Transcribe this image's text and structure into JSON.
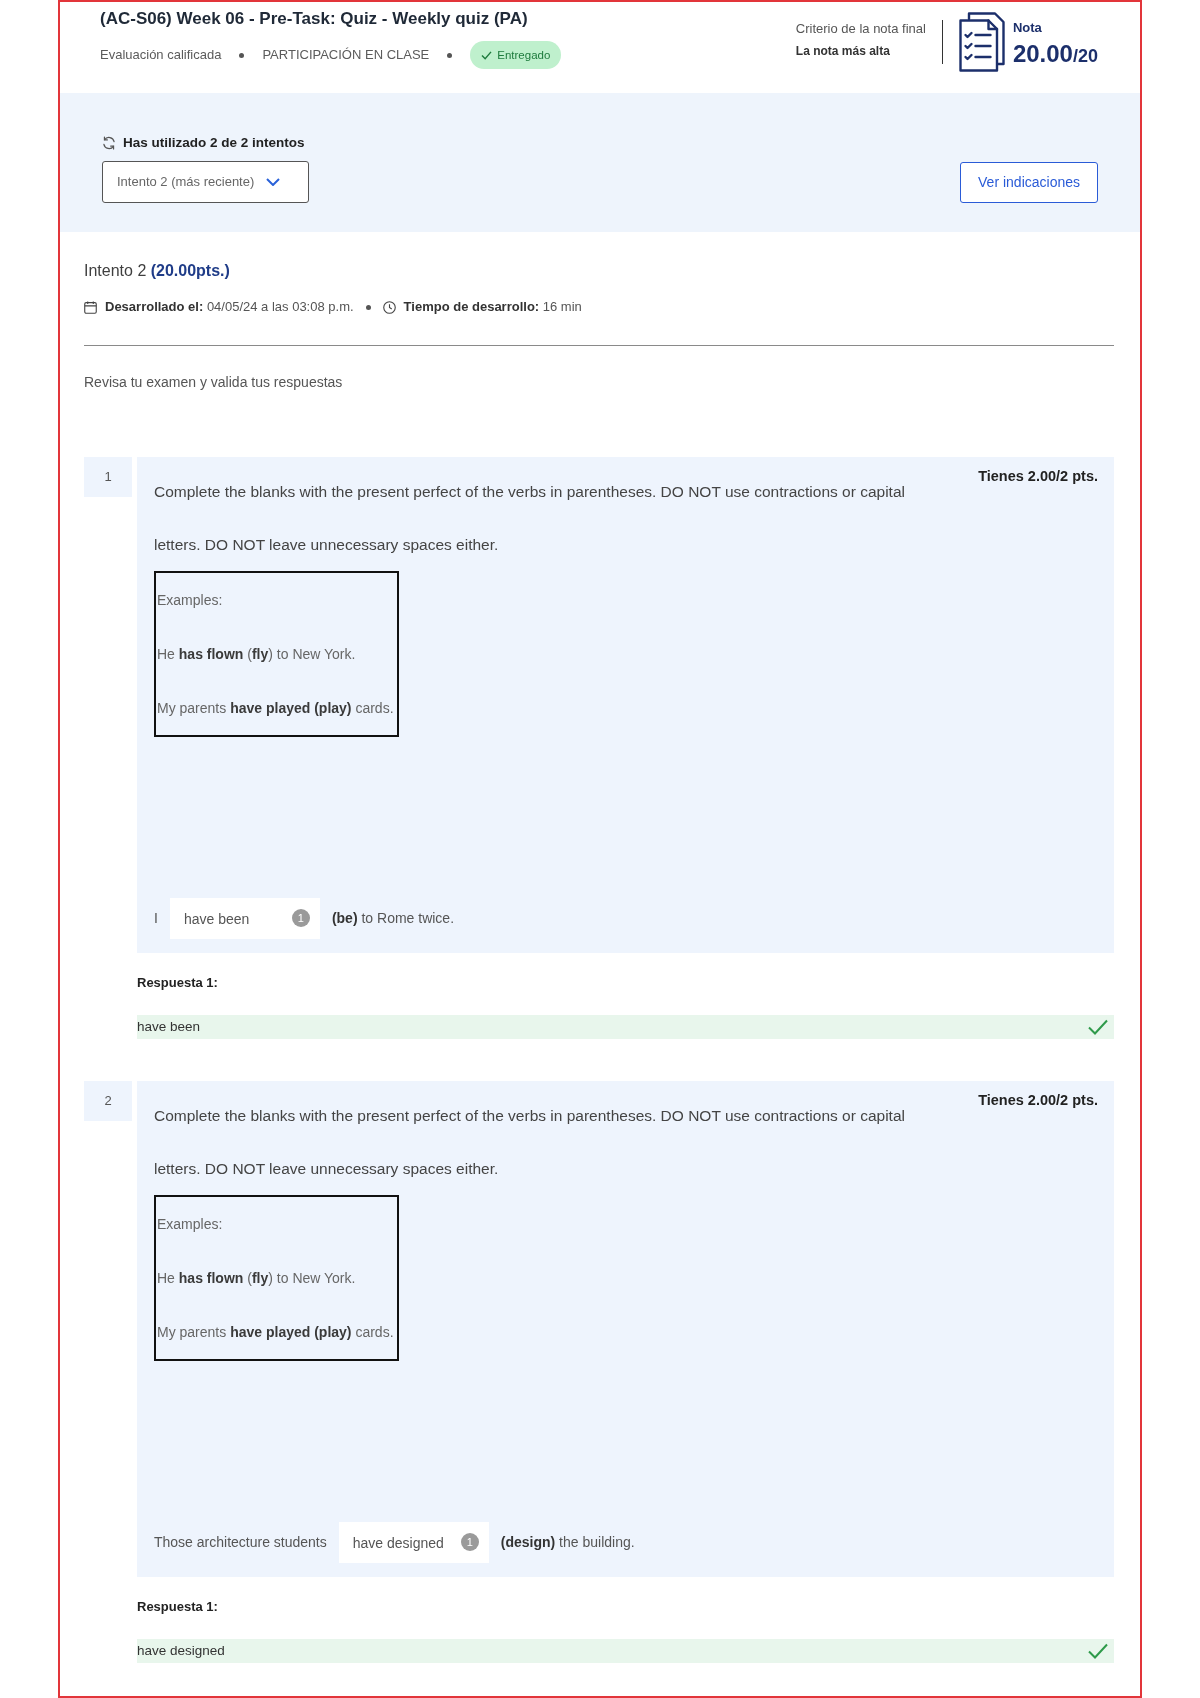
{
  "header": {
    "title": "(AC-S06) Week 06 - Pre-Task: Quiz - Weekly quiz (PA)",
    "meta": [
      "Evaluación calificada",
      "PARTICIPACIÓN EN CLASE"
    ],
    "status": "Entregado",
    "criterion_label": "Criterio de la nota final",
    "criterion_value": "La nota más alta",
    "grade_label": "Nota",
    "grade": "20.00",
    "grade_max": "/20"
  },
  "attempts": {
    "summary": "Has utilizado 2 de 2 intentos",
    "selector": {
      "value": "Intento 2 (más reciente)"
    },
    "button": "Ver indicaciones"
  },
  "attempt": {
    "title": "Intento 2 **(20.00pts.)**",
    "developed": "**Desarrollado el:** 04/05/24 a las 03:08 p.m.",
    "duration": "**Tiempo de desarrollo:** 16 min"
  },
  "instructions": "Revisa tu examen y valida tus respuestas",
  "questions": [
    {
      "number": "1",
      "score": "Tienes 2.00/2 pts.",
      "prompt": "Complete the blanks with the present perfect of the verbs in parentheses. DO NOT use contractions or capital letters. DO NOT leave unnecessary spaces either.",
      "examples": [
        "Examples:",
        "He **has flown** (**fly**) to New York.",
        "My parents **have played (play)** cards."
      ],
      "sentence_before": "I",
      "blank": {
        "value": "have been",
        "badge": "1"
      },
      "sentence_after": "**(be)** to Rome twice.",
      "answer_label": "Respuesta 1:",
      "answer": "have been",
      "correct": true
    },
    {
      "number": "2",
      "score": "Tienes 2.00/2 pts.",
      "prompt": "Complete the blanks with the present perfect of the verbs in parentheses. DO NOT use contractions or capital letters. DO NOT leave unnecessary spaces either.",
      "examples": [
        "Examples:",
        "He **has flown** (**fly**) to New York.",
        "My parents **have played (play)** cards."
      ],
      "sentence_before": "Those architecture students",
      "blank": {
        "value": "have designed",
        "badge": "1"
      },
      "sentence_after": "**(design)** the building.",
      "answer_label": "Respuesta 1:",
      "answer": "have designed",
      "correct": true
    }
  ]
}
